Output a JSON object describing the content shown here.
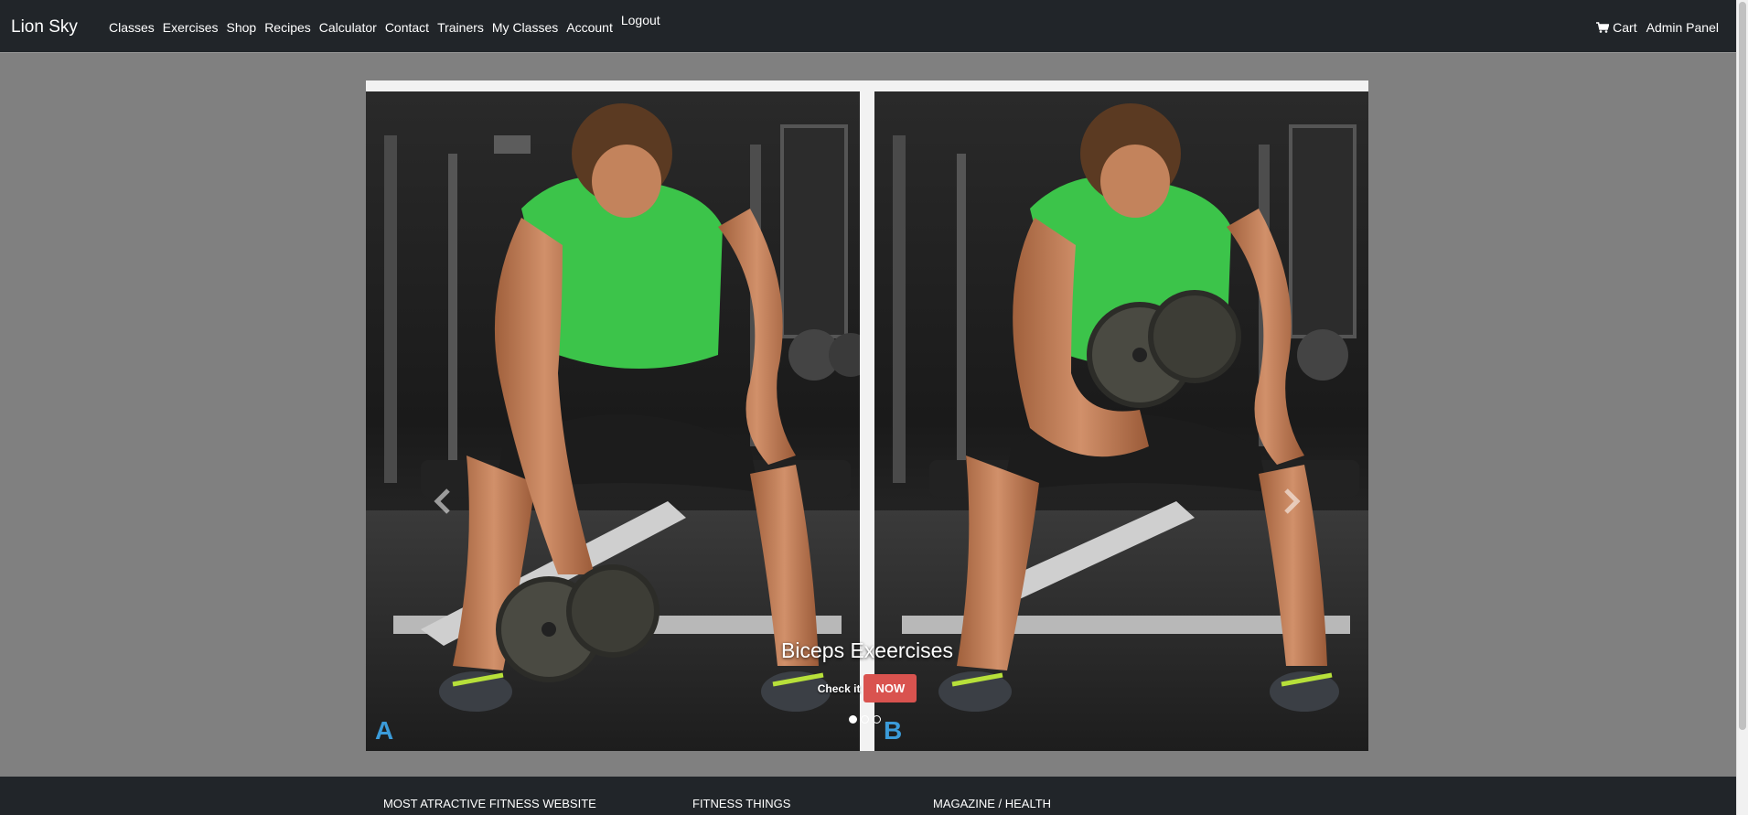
{
  "navbar": {
    "brand": "Lion Sky",
    "links": [
      {
        "label": "Classes"
      },
      {
        "label": "Exercises"
      },
      {
        "label": "Shop"
      },
      {
        "label": "Recipes"
      },
      {
        "label": "Calculator"
      },
      {
        "label": "Contact"
      },
      {
        "label": "Trainers"
      },
      {
        "label": "My Classes"
      },
      {
        "label": "Account"
      },
      {
        "label": "Logout"
      }
    ],
    "right": {
      "cart": "Cart",
      "admin": "Admin Panel"
    }
  },
  "carousel": {
    "slide": {
      "image": "biceps-curl-photo",
      "image_panel_labels": [
        "A",
        "B"
      ],
      "title": "Biceps Exeercises",
      "check_text": "Check it",
      "button": "NOW"
    },
    "indicator_count": 3,
    "active_indicator": 0,
    "prev_icon": "chevron-left-icon",
    "next_icon": "chevron-right-icon"
  },
  "footer": {
    "columns": [
      {
        "heading": "MOST ATRACTIVE FITNESS WEBSITE"
      },
      {
        "heading": "FITNESS THINGS"
      },
      {
        "heading": "MAGAZINE / HEALTH"
      }
    ]
  },
  "colors": {
    "navbar_bg": "#212529",
    "page_bg": "#808080",
    "accent_button": "#d9534f",
    "shirt_green": "#3cc44a"
  }
}
